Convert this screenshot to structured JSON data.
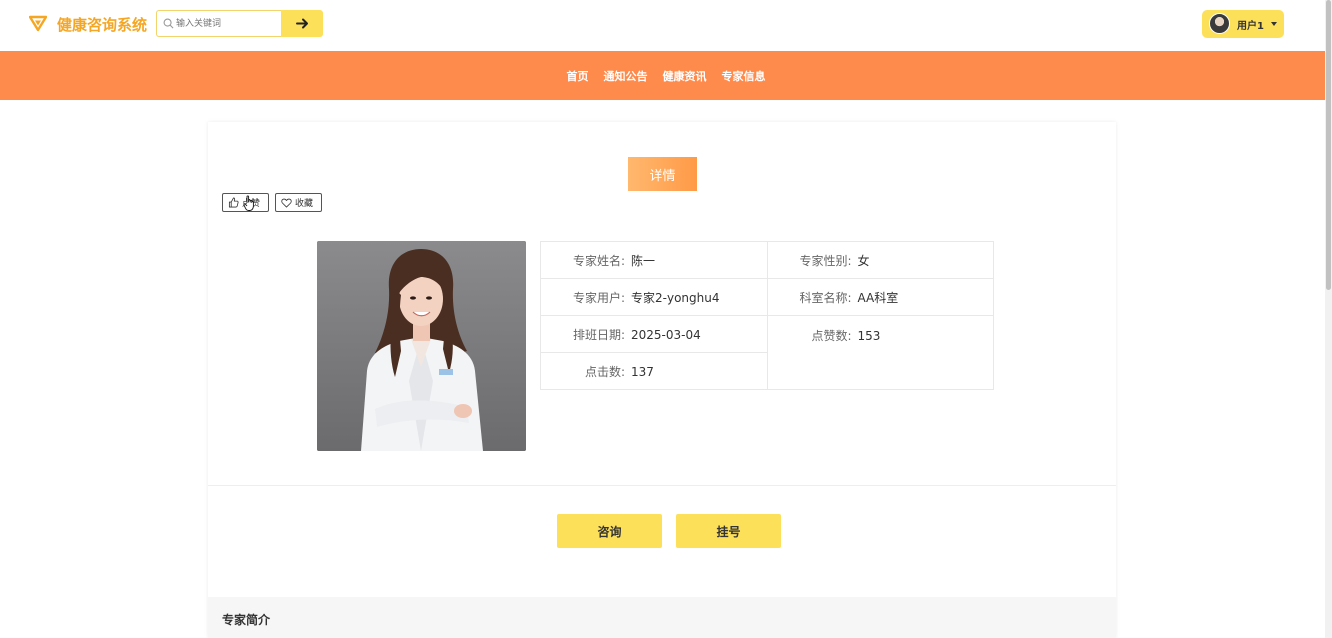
{
  "header": {
    "logo_text": "健康咨询系统",
    "search_placeholder": "输入关键词",
    "user_name": "用户1",
    "brand_color": "#f5a623",
    "accent_color": "#fde05a"
  },
  "nav": {
    "items": [
      {
        "label": "首页"
      },
      {
        "label": "通知公告"
      },
      {
        "label": "健康资讯"
      },
      {
        "label": "专家信息"
      }
    ],
    "bg_color": "#fe8a4b"
  },
  "detail": {
    "tab_label": "详情",
    "like_label": "点赞",
    "favorite_label": "收藏",
    "fields": {
      "name_label": "专家姓名:",
      "name_value": "陈一",
      "gender_label": "专家性别:",
      "gender_value": "女",
      "user_label": "专家用户:",
      "user_value": "专家2-yonghu4",
      "dept_label": "科室名称:",
      "dept_value": "AA科室",
      "date_label": "排班日期:",
      "date_value": "2025-03-04",
      "likes_label": "点赞数:",
      "likes_value": "153",
      "clicks_label": "点击数:",
      "clicks_value": "137"
    },
    "consult_label": "咨询",
    "register_label": "挂号",
    "intro_title": "专家简介"
  }
}
